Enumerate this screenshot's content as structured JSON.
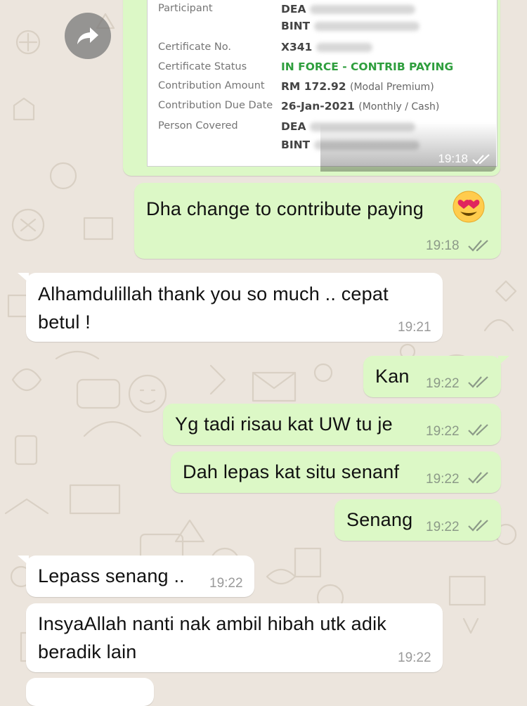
{
  "doc": {
    "rows": [
      {
        "label": "Participant",
        "value": "DEA",
        "value2": "BINT"
      },
      {
        "label": "Certificate No.",
        "value": "X341"
      },
      {
        "label": "Certificate Status",
        "value": "IN FORCE - CONTRIB PAYING"
      },
      {
        "label": "Contribution Amount",
        "value": "RM 172.92",
        "sub": "(Modal Premium)"
      },
      {
        "label": "Contribution Due Date",
        "value": "26-Jan-2021",
        "sub": "(Monthly / Cash)"
      },
      {
        "label": "Person Covered",
        "value": "DEA",
        "value2": "BINT"
      }
    ],
    "status_color": "#2e9e3d",
    "time": "19:18"
  },
  "messages": [
    {
      "side": "out",
      "lines": [
        "Dha change to contribute paying"
      ],
      "emoji": "smiling-face-with-heart-eyes",
      "time": "19:18"
    },
    {
      "side": "in",
      "lines": [
        "Alhamdulillah thank you so much .. cepat",
        "betul !"
      ],
      "time": "19:21"
    },
    {
      "side": "out",
      "lines": [
        "Kan"
      ],
      "time": "19:22"
    },
    {
      "side": "out",
      "lines": [
        "Yg tadi risau kat UW tu je"
      ],
      "time": "19:22"
    },
    {
      "side": "out",
      "lines": [
        "Dah lepas kat situ senanf"
      ],
      "time": "19:22"
    },
    {
      "side": "out",
      "lines": [
        "Senang"
      ],
      "time": "19:22"
    },
    {
      "side": "in",
      "lines": [
        "Lepass senang .."
      ],
      "time": "19:22"
    },
    {
      "side": "in",
      "lines": [
        "InsyaAllah nanti nak ambil hibah utk adik",
        "beradik lain"
      ],
      "time": "19:22"
    }
  ],
  "colors": {
    "outgoing": "#dcf8c6",
    "incoming": "#ffffff",
    "wallpaper": "#ece5dd"
  }
}
